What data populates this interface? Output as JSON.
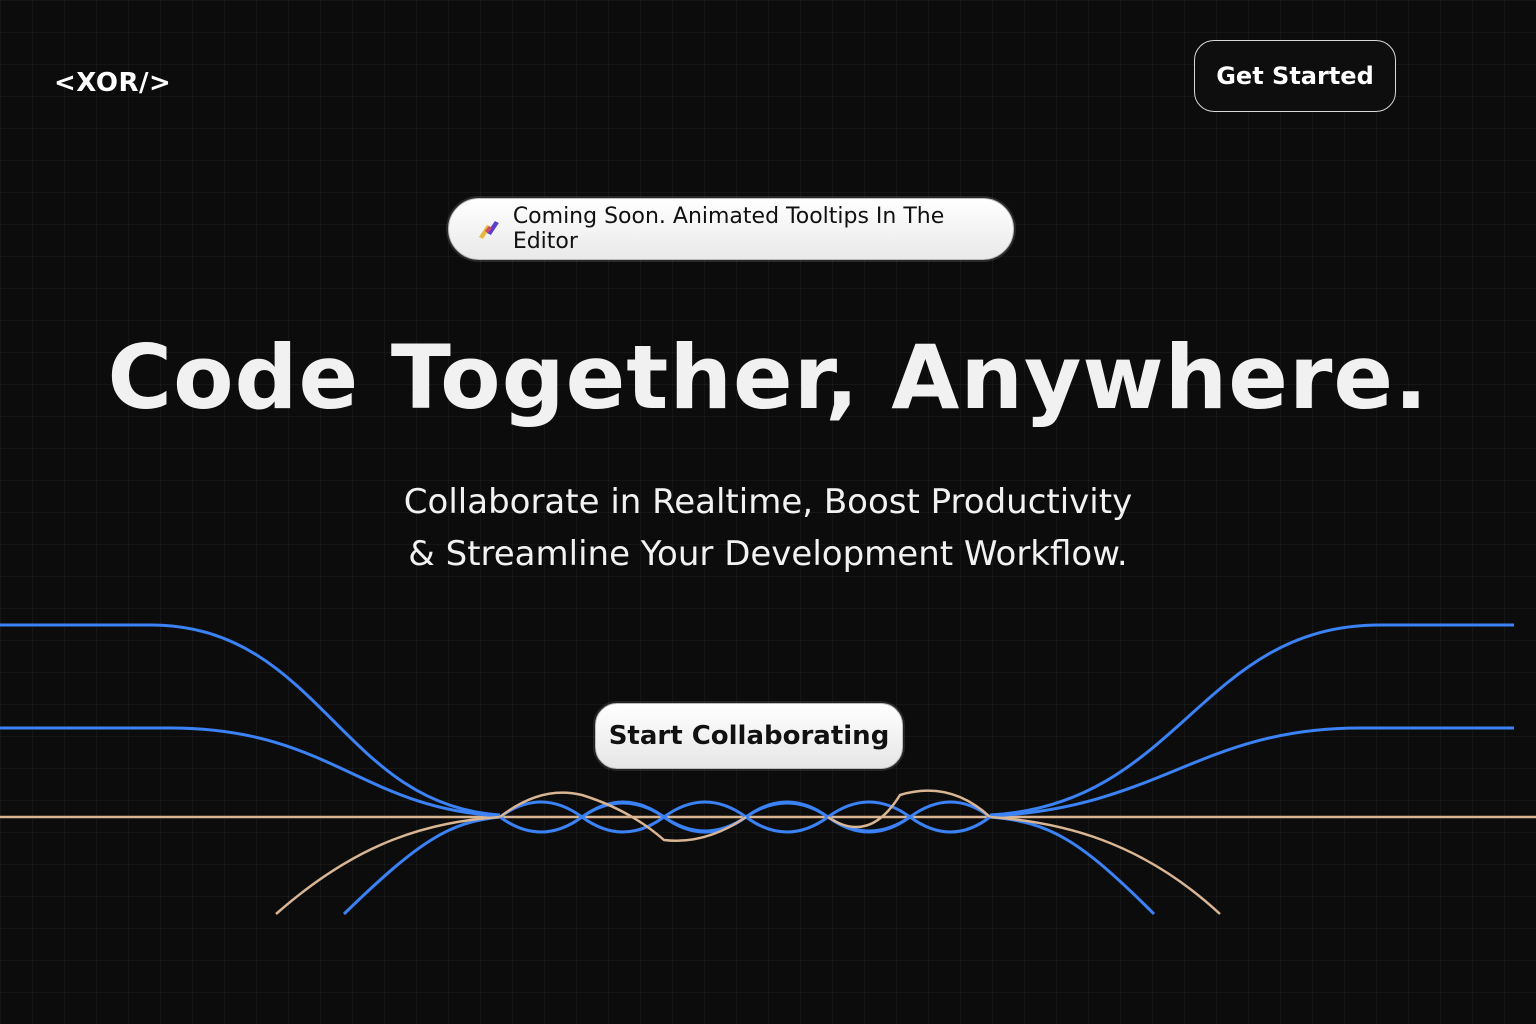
{
  "header": {
    "logo_text": "<XOR/>",
    "cta_label": "Get Started"
  },
  "announcement": {
    "icon": "sparkle-icon",
    "text": "Coming Soon. Animated Tooltips In The Editor"
  },
  "hero": {
    "title": "Code Together, Anywhere.",
    "subtitle_lines": [
      "Collaborate in Realtime, Boost Productivity",
      "& Streamline Your Development Workflow."
    ],
    "cta_label": "Start Collaborating"
  },
  "colors": {
    "background": "#0c0c0c",
    "wave_blue": "#3b82f6",
    "wave_beige": "#d9b594",
    "button_bg": "#ffffff"
  }
}
